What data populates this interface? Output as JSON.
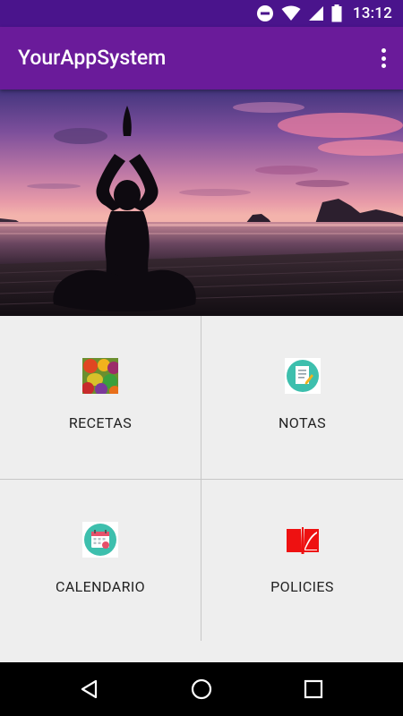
{
  "status_bar": {
    "time": "13:12",
    "icons": [
      "do-not-disturb-icon",
      "wifi-icon",
      "signal-icon",
      "battery-icon"
    ]
  },
  "app_bar": {
    "title": "YourAppSystem",
    "overflow_icon": "more-vert-icon"
  },
  "hero": {
    "image": "yoga-sunset-photo"
  },
  "menu": {
    "items": [
      {
        "label": "RECETAS",
        "icon": "fruits-icon"
      },
      {
        "label": "NOTAS",
        "icon": "notes-icon"
      },
      {
        "label": "CALENDARIO",
        "icon": "calendar-icon"
      },
      {
        "label": "POLICIES",
        "icon": "book-icon"
      }
    ]
  },
  "nav_bar": {
    "buttons": [
      "back-icon",
      "home-icon",
      "recents-icon"
    ]
  },
  "colors": {
    "status_bar": "#4a148c",
    "app_bar": "#6a1b9a",
    "grid_background": "#eeeeee",
    "policies_icon": "#ee1111",
    "icon_teal": "#3dbfad"
  }
}
